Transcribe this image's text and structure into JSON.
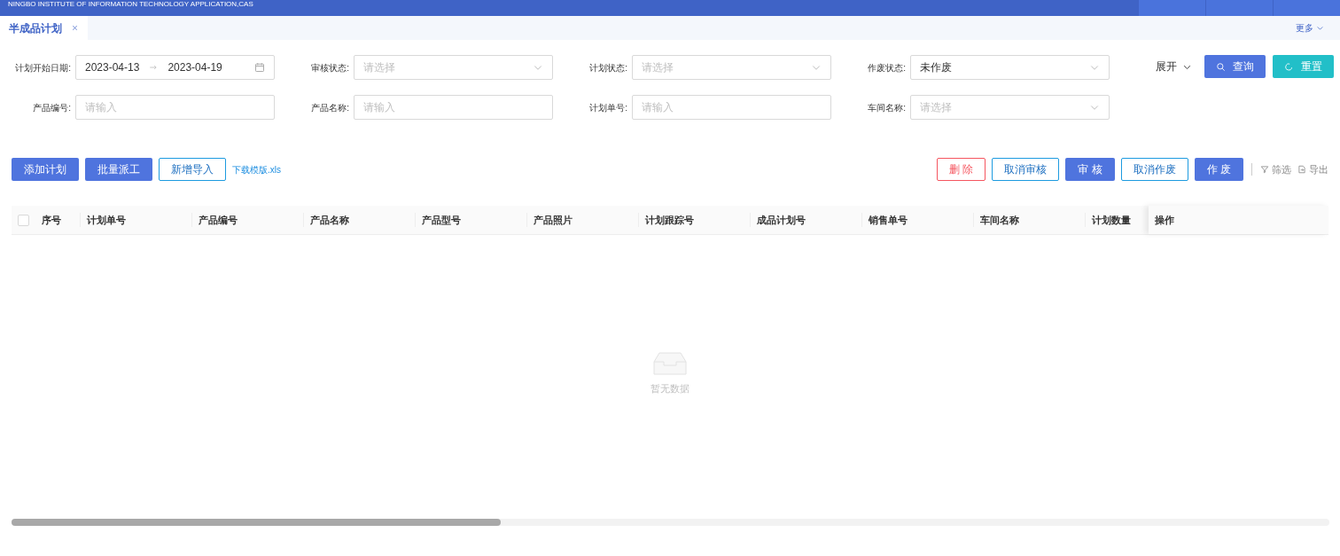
{
  "header": {
    "title": "NINGBO INSTITUTE OF INFORMATION TECHNOLOGY APPLICATION,CAS"
  },
  "tabs": [
    {
      "label": "半成品计划",
      "selected": true
    }
  ],
  "more_menu": {
    "label": "更多"
  },
  "filters": [
    {
      "label": "计划开始日期:",
      "kind": "daterange",
      "start": "2023-04-13",
      "end": "2023-04-19"
    },
    {
      "label": "审核状态:",
      "kind": "select",
      "placeholder": "请选择"
    },
    {
      "label": "计划状态:",
      "kind": "select",
      "placeholder": "请选择"
    },
    {
      "label": "作废状态:",
      "kind": "select",
      "value": "未作废"
    },
    {
      "label": "产品编号:",
      "kind": "input",
      "placeholder": "请输入"
    },
    {
      "label": "产品名称:",
      "kind": "input",
      "placeholder": "请输入"
    },
    {
      "label": "计划单号:",
      "kind": "input",
      "placeholder": "请输入"
    },
    {
      "label": "车间名称:",
      "kind": "select",
      "placeholder": "请选择"
    }
  ],
  "expand": {
    "label": "展开"
  },
  "search_button": {
    "label": "查询"
  },
  "reset_button": {
    "label": "重置"
  },
  "left_actions": [
    {
      "label": "添加计划",
      "kind": "primary"
    },
    {
      "label": "批量派工",
      "kind": "primary"
    },
    {
      "label": "新增导入",
      "kind": "outline"
    },
    {
      "label": "下载模版.xls",
      "kind": "link"
    }
  ],
  "right_actions": [
    {
      "label": "删 除",
      "kind": "danger"
    },
    {
      "label": "取消审核",
      "kind": "outline"
    },
    {
      "label": "审 核",
      "kind": "primary"
    },
    {
      "label": "取消作废",
      "kind": "outline"
    },
    {
      "label": "作 废",
      "kind": "primary"
    }
  ],
  "tools": [
    {
      "label": "筛选",
      "kind": "filter"
    },
    {
      "label": "导出",
      "kind": "export"
    }
  ],
  "table": {
    "select_all": {
      "checked": false
    },
    "columns": [
      "序号",
      "计划单号",
      "产品编号",
      "产品名称",
      "产品型号",
      "产品照片",
      "计划跟踪号",
      "成品计划号",
      "销售单号",
      "车间名称",
      "计划数量"
    ],
    "action_column": "操作",
    "empty_text": "暂无数据"
  }
}
